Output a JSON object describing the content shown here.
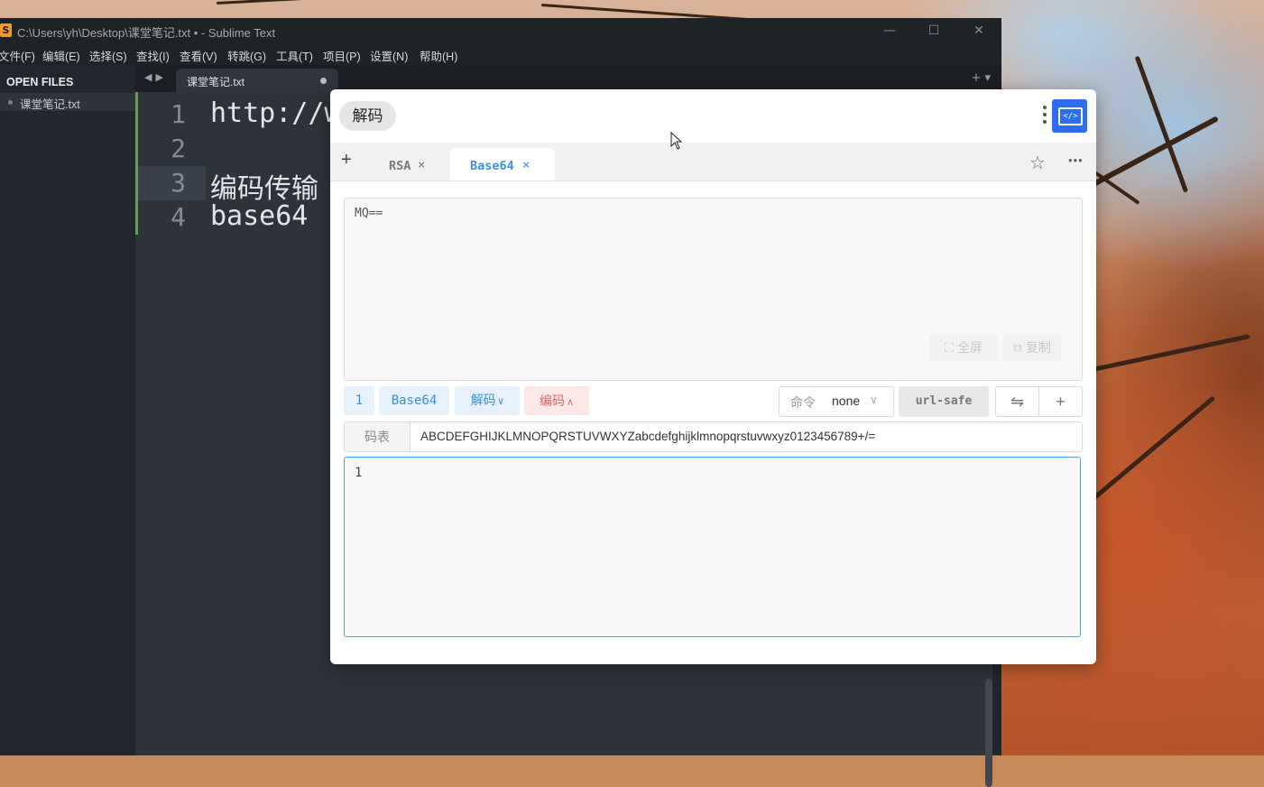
{
  "sublime": {
    "title": "C:\\Users\\yh\\Desktop\\课堂笔记.txt • - Sublime Text",
    "window_controls": [
      "—",
      "☐",
      "✕"
    ],
    "menu": [
      "文件(F)",
      "编辑(E)",
      "选择(S)",
      "查找(I)",
      "查看(V)",
      "转跳(G)",
      "工具(T)",
      "项目(P)",
      "设置(N)",
      "帮助(H)"
    ],
    "sidebar": {
      "header": "OPEN FILES",
      "files": [
        "课堂笔记.txt"
      ]
    },
    "tab": {
      "name": "课堂笔记.txt"
    },
    "tab_controls": "+ ▾",
    "nav_arrows": "◀▶",
    "lines": [
      {
        "num": "1",
        "text": "http://w"
      },
      {
        "num": "2",
        "text": ""
      },
      {
        "num": "3",
        "text": "编码传输"
      },
      {
        "num": "4",
        "text": "base64"
      }
    ]
  },
  "tool": {
    "mode_pill": "解码",
    "tabs": {
      "add": "+",
      "rsa": "RSA",
      "base64": "Base64",
      "close": "×"
    },
    "icons": {
      "star": "☆",
      "more": "•••",
      "app": "</>"
    },
    "input": {
      "value": "MQ==",
      "fullscreen": "⛶ 全屏",
      "copy": "⧉ 复制"
    },
    "toolbar": {
      "count": "1",
      "algo": "Base64",
      "decode": "解码",
      "encode": "编码",
      "cmd_label": "命令",
      "cmd_value": "none",
      "url_safe": "url-safe",
      "swap": "⇋",
      "add": "+"
    },
    "alphabet": {
      "label": "码表",
      "value": "ABCDEFGHIJKLMNOPQRSTUVWXYZabcdefghijklmnopqrstuvwxyz0123456789+/="
    },
    "output": {
      "value": "1"
    }
  },
  "colors": {
    "accent": "#3a93e0",
    "app_icon": "#2d6ef0",
    "encode_red": "#e06565"
  }
}
